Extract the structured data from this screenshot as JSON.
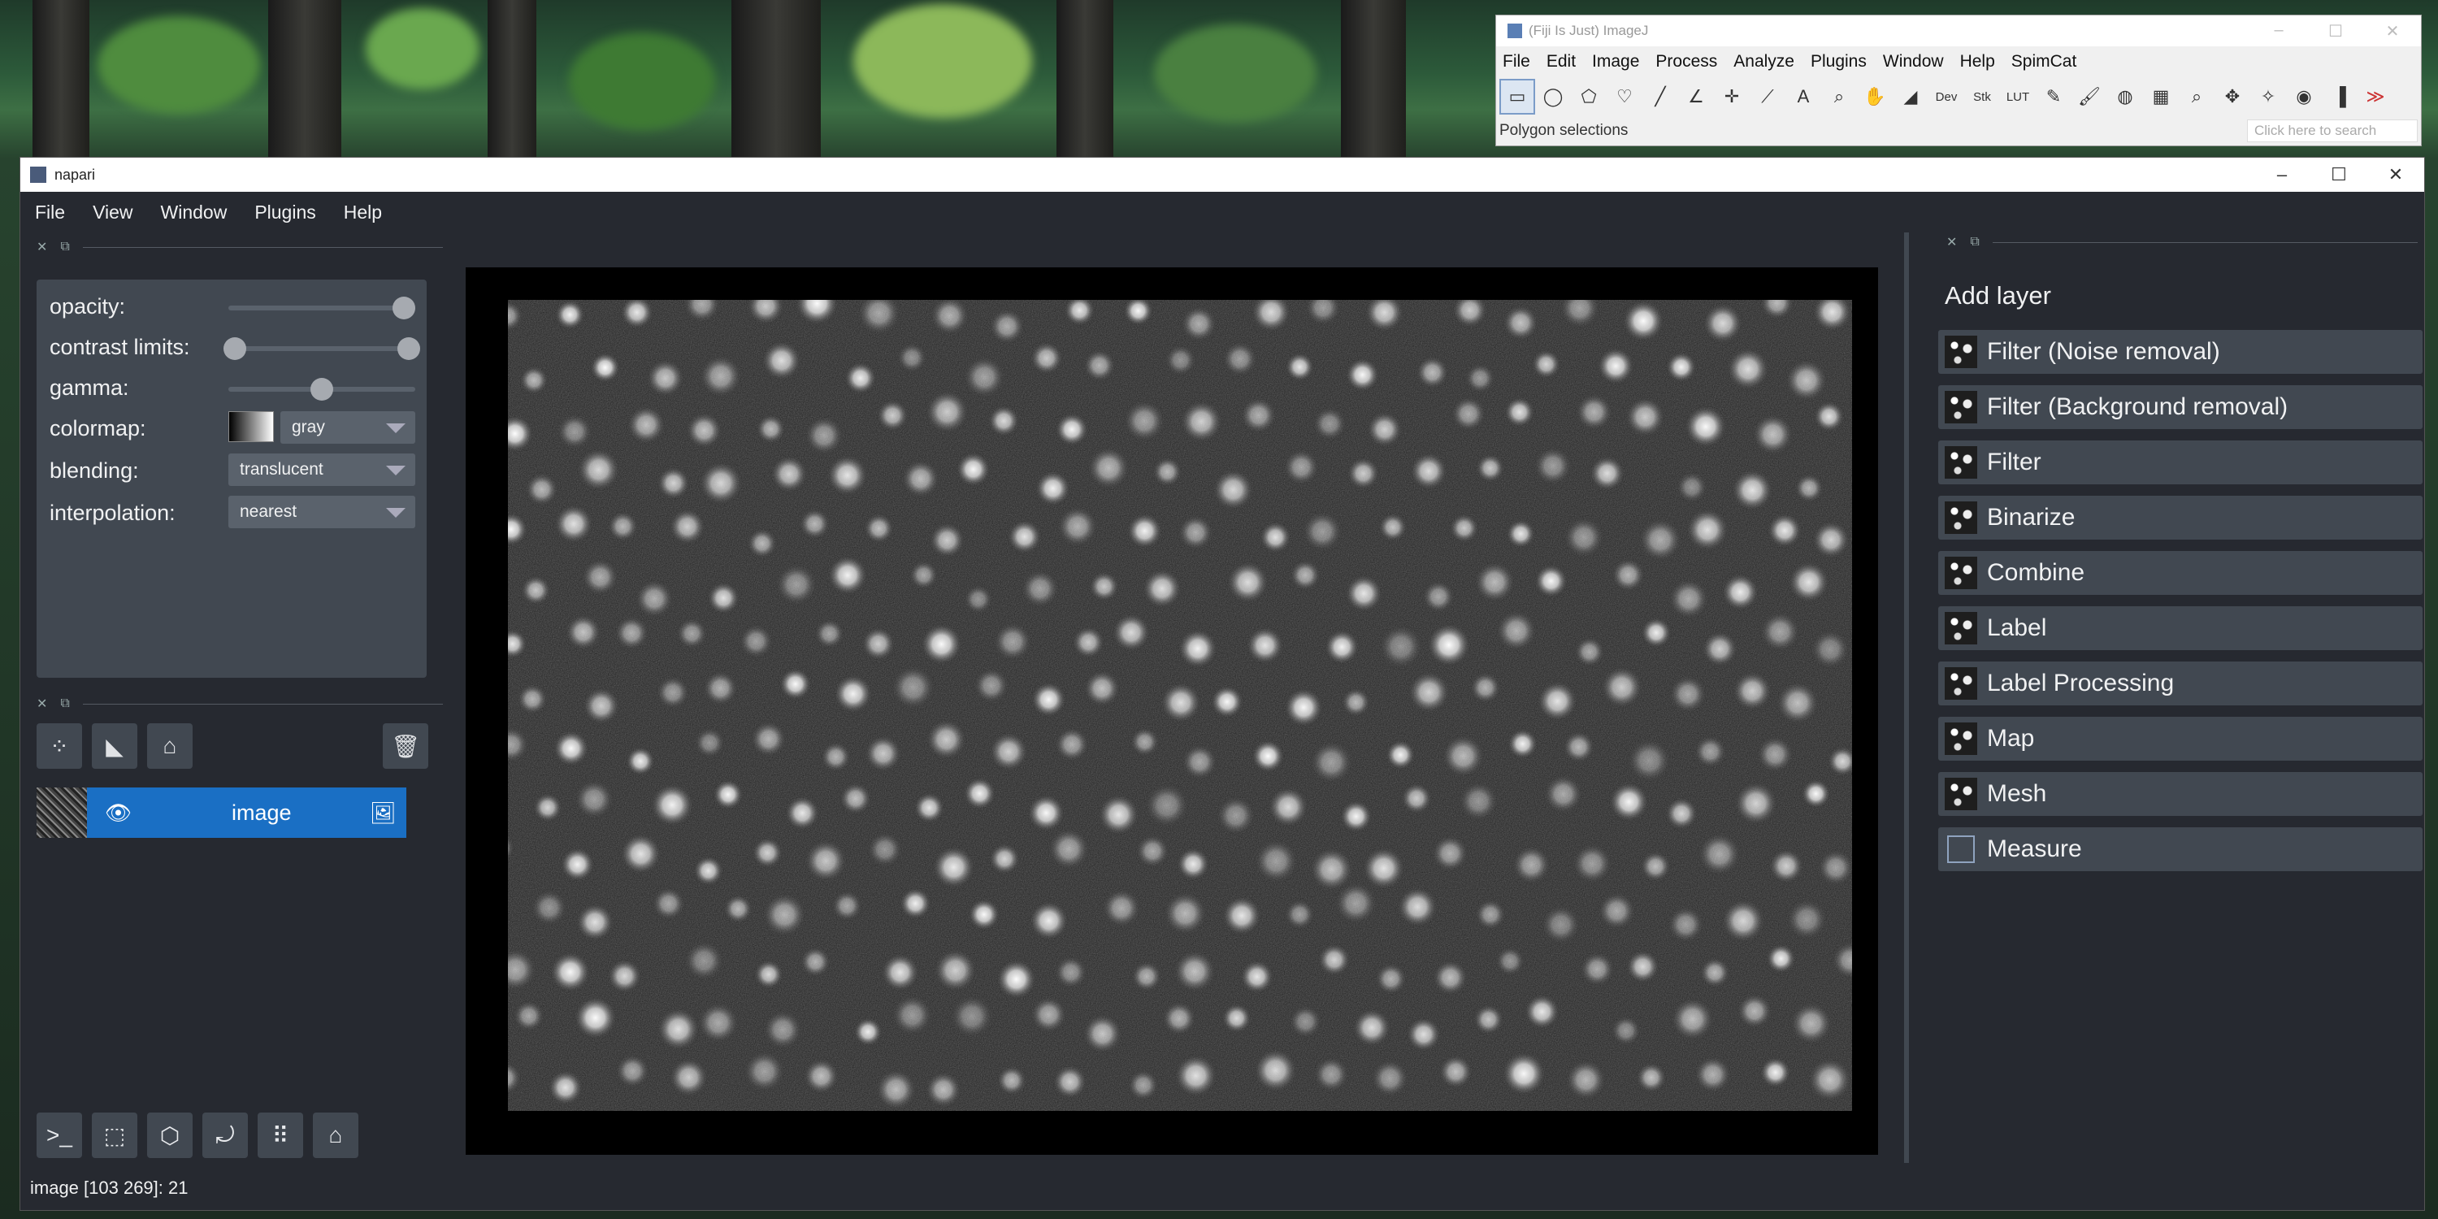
{
  "fiji": {
    "title": "(Fiji Is Just) ImageJ",
    "menu": [
      "File",
      "Edit",
      "Image",
      "Process",
      "Analyze",
      "Plugins",
      "Window",
      "Help",
      "SpimCat"
    ],
    "status": "Polygon selections",
    "search_placeholder": "Click here to search",
    "tool_labels": {
      "dev": "Dev",
      "stk": "Stk",
      "lut": "LUT"
    }
  },
  "napari": {
    "title": "napari",
    "menu": [
      "File",
      "View",
      "Window",
      "Plugins",
      "Help"
    ],
    "controls": {
      "opacity_label": "opacity:",
      "contrast_label": "contrast limits:",
      "gamma_label": "gamma:",
      "colormap_label": "colormap:",
      "colormap_value": "gray",
      "blending_label": "blending:",
      "blending_value": "translucent",
      "interpolation_label": "interpolation:",
      "interpolation_value": "nearest",
      "opacity_value": 1.0,
      "gamma_fraction": 0.5
    },
    "layer": {
      "name": "image"
    },
    "status": "image [103 269]: 21",
    "add_layer_title": "Add layer",
    "plugins": [
      {
        "label": "Filter (Noise removal)"
      },
      {
        "label": "Filter (Background removal)"
      },
      {
        "label": "Filter"
      },
      {
        "label": "Binarize"
      },
      {
        "label": "Combine"
      },
      {
        "label": "Label"
      },
      {
        "label": "Label Processing"
      },
      {
        "label": "Map"
      },
      {
        "label": "Mesh"
      },
      {
        "label": "Measure"
      }
    ]
  },
  "colors": {
    "accent": "#1a6fc4",
    "panel": "#414851",
    "bg": "#262930"
  }
}
